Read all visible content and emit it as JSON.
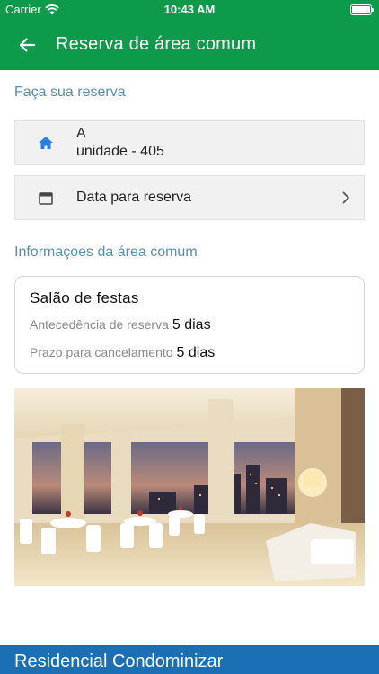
{
  "status_bar": {
    "carrier": "Carrier",
    "time": "10:43 AM"
  },
  "header": {
    "title": "Reserva de área comum",
    "back_icon": "arrow-left-icon"
  },
  "reservation": {
    "section_title": "Faça sua reserva",
    "unit": {
      "block": "A",
      "unit": "unidade - 405",
      "icon": "home-icon"
    },
    "date": {
      "label": "Data para reserva",
      "icon": "calendar-icon"
    }
  },
  "common_area": {
    "section_title": "Informaçoes da área comum",
    "name": "Salão de festas",
    "advance_label": "Antecedência de reserva",
    "advance_value": "5 dias",
    "cancel_label": "Prazo para cancelamento",
    "cancel_value": "5 dias"
  },
  "footer": {
    "text": "Residencial Condominizar"
  },
  "colors": {
    "header": "#0e9a4b",
    "footer": "#1a6fb5",
    "section_title": "#5a8fb0",
    "icon_blue": "#2b7de0"
  }
}
